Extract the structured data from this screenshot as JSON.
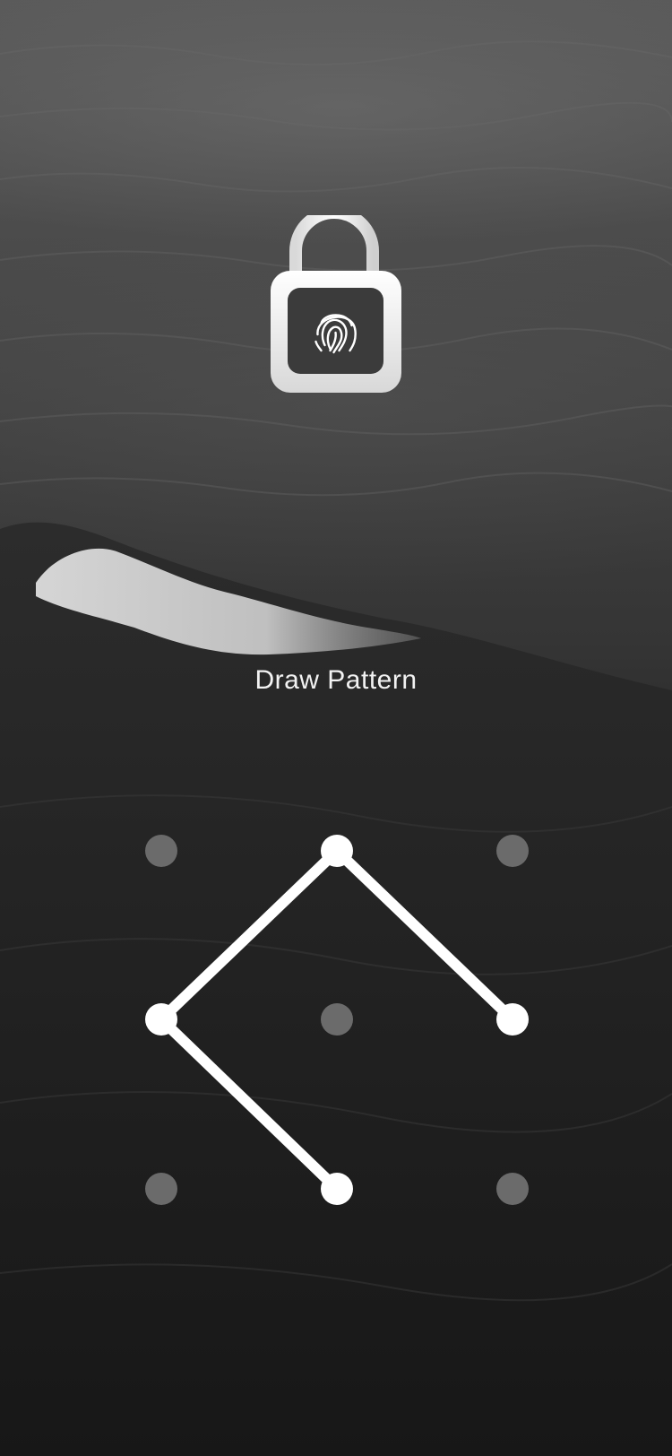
{
  "lock_screen": {
    "title": "Draw Pattern",
    "lock_icon": "unlocked-padlock-fingerprint-icon"
  },
  "pattern": {
    "grid_size": 3,
    "selected_dots": [
      1,
      3,
      5,
      7
    ],
    "path_order": [
      5,
      1,
      3,
      7
    ],
    "dot_active_color": "#ffffff",
    "dot_inactive_color": "#6b6b6b",
    "line_color": "#ffffff"
  },
  "colors": {
    "text": "#f2f2f2",
    "lock_body": "#f0f0f0"
  }
}
